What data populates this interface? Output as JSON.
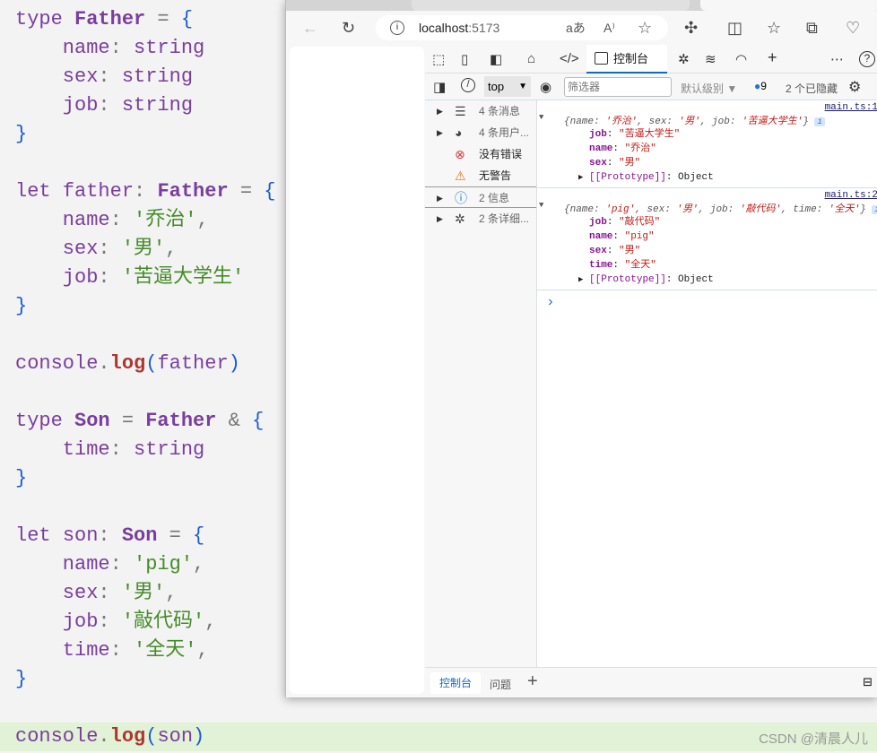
{
  "editor": {
    "lines": [
      [
        [
          "type ",
          "kw"
        ],
        [
          "Father",
          "ty"
        ],
        [
          " = ",
          "op"
        ],
        [
          "{",
          "br"
        ]
      ],
      [
        [
          "    name",
          "pr"
        ],
        [
          ": ",
          "op"
        ],
        [
          "string",
          "pl"
        ]
      ],
      [
        [
          "    sex",
          "pr"
        ],
        [
          ": ",
          "op"
        ],
        [
          "string",
          "pl"
        ]
      ],
      [
        [
          "    job",
          "pr"
        ],
        [
          ": ",
          "op"
        ],
        [
          "string",
          "pl"
        ]
      ],
      [
        [
          "}",
          "br"
        ]
      ],
      [],
      [
        [
          "let ",
          "kw"
        ],
        [
          "father",
          "kw"
        ],
        [
          ": ",
          "op"
        ],
        [
          "Father",
          "ty"
        ],
        [
          " = ",
          "op"
        ],
        [
          "{",
          "br"
        ]
      ],
      [
        [
          "    name",
          "pr"
        ],
        [
          ": ",
          "op"
        ],
        [
          "'乔治'",
          "st"
        ],
        [
          ",",
          "op"
        ]
      ],
      [
        [
          "    sex",
          "pr"
        ],
        [
          ": ",
          "op"
        ],
        [
          "'男'",
          "st"
        ],
        [
          ",",
          "op"
        ]
      ],
      [
        [
          "    job",
          "pr"
        ],
        [
          ": ",
          "op"
        ],
        [
          "'苦逼大学生'",
          "st"
        ]
      ],
      [
        [
          "}",
          "br"
        ]
      ],
      [],
      [
        [
          "console",
          "kw"
        ],
        [
          ".",
          "op"
        ],
        [
          "log",
          "fn"
        ],
        [
          "(",
          "br"
        ],
        [
          "father",
          "kw"
        ],
        [
          ")",
          "br"
        ]
      ],
      [],
      [
        [
          "type ",
          "kw"
        ],
        [
          "Son",
          "ty"
        ],
        [
          " = ",
          "op"
        ],
        [
          "Father",
          "ty"
        ],
        [
          " & ",
          "op"
        ],
        [
          "{",
          "br"
        ]
      ],
      [
        [
          "    time",
          "pr"
        ],
        [
          ": ",
          "op"
        ],
        [
          "string",
          "pl"
        ]
      ],
      [
        [
          "}",
          "br"
        ]
      ],
      [],
      [
        [
          "let ",
          "kw"
        ],
        [
          "son",
          "kw"
        ],
        [
          ": ",
          "op"
        ],
        [
          "Son",
          "ty"
        ],
        [
          " = ",
          "op"
        ],
        [
          "{",
          "br"
        ]
      ],
      [
        [
          "    name",
          "pr"
        ],
        [
          ": ",
          "op"
        ],
        [
          "'pig'",
          "st"
        ],
        [
          ",",
          "op"
        ]
      ],
      [
        [
          "    sex",
          "pr"
        ],
        [
          ": ",
          "op"
        ],
        [
          "'男'",
          "st"
        ],
        [
          ",",
          "op"
        ]
      ],
      [
        [
          "    job",
          "pr"
        ],
        [
          ": ",
          "op"
        ],
        [
          "'敲代码'",
          "st"
        ],
        [
          ",",
          "op"
        ]
      ],
      [
        [
          "    time",
          "pr"
        ],
        [
          ": ",
          "op"
        ],
        [
          "'全天'",
          "st"
        ],
        [
          ",",
          "op"
        ]
      ],
      [
        [
          "}",
          "br"
        ]
      ],
      [],
      [
        [
          "console",
          "kw"
        ],
        [
          ".",
          "op"
        ],
        [
          "log",
          "fn"
        ],
        [
          "(",
          "br"
        ],
        [
          "son",
          "kw"
        ],
        [
          ")",
          "br"
        ]
      ]
    ]
  },
  "browser": {
    "url_host": "localhost",
    "url_port": ":5173"
  },
  "devtools": {
    "console_tab": "控制台",
    "context": "top",
    "filter_placeholder": "筛选器",
    "level": "默认级别",
    "msg_count": "9",
    "hidden": "2 个已隐藏"
  },
  "sidebar": [
    {
      "label": "4 条消息",
      "icon": "list",
      "arrow": true
    },
    {
      "label": "4 条用户...",
      "icon": "user",
      "arrow": true
    },
    {
      "label": "没有错误",
      "icon": "error",
      "arrow": false
    },
    {
      "label": "无警告",
      "icon": "warning",
      "arrow": false
    },
    {
      "label": "2 信息",
      "icon": "info",
      "arrow": true
    },
    {
      "label": "2 条详细...",
      "icon": "bug",
      "arrow": true
    }
  ],
  "console": {
    "messages": [
      {
        "source": "main.ts:1",
        "summary": [
          [
            "{name: ",
            "p"
          ],
          [
            "'乔治'",
            "s"
          ],
          [
            ", sex: ",
            "p"
          ],
          [
            "'男'",
            "s"
          ],
          [
            ", job: ",
            "p"
          ],
          [
            "'苦逼大学生'",
            "s"
          ],
          [
            "}",
            "p"
          ]
        ],
        "props": [
          [
            "job",
            "\"苦逼大学生\""
          ],
          [
            "name",
            "\"乔治\""
          ],
          [
            "sex",
            "\"男\""
          ]
        ],
        "proto": "[[Prototype]]",
        "proto_val": ": Object"
      },
      {
        "source": "main.ts:2",
        "summary": [
          [
            "{name: ",
            "p"
          ],
          [
            "'pig'",
            "s"
          ],
          [
            ", sex: ",
            "p"
          ],
          [
            "'男'",
            "s"
          ],
          [
            ", job: ",
            "p"
          ],
          [
            "'敲代码'",
            "s"
          ],
          [
            ", time: ",
            "p"
          ],
          [
            "'全天'",
            "s"
          ],
          [
            "}",
            "p"
          ]
        ],
        "props": [
          [
            "job",
            "\"敲代码\""
          ],
          [
            "name",
            "\"pig\""
          ],
          [
            "sex",
            "\"男\""
          ],
          [
            "time",
            "\"全天\""
          ]
        ],
        "proto": "[[Prototype]]",
        "proto_val": ": Object"
      }
    ],
    "prompt": "›"
  },
  "drawer": {
    "tabs": [
      "控制台",
      "问题"
    ]
  },
  "watermark": "CSDN @清晨人儿"
}
